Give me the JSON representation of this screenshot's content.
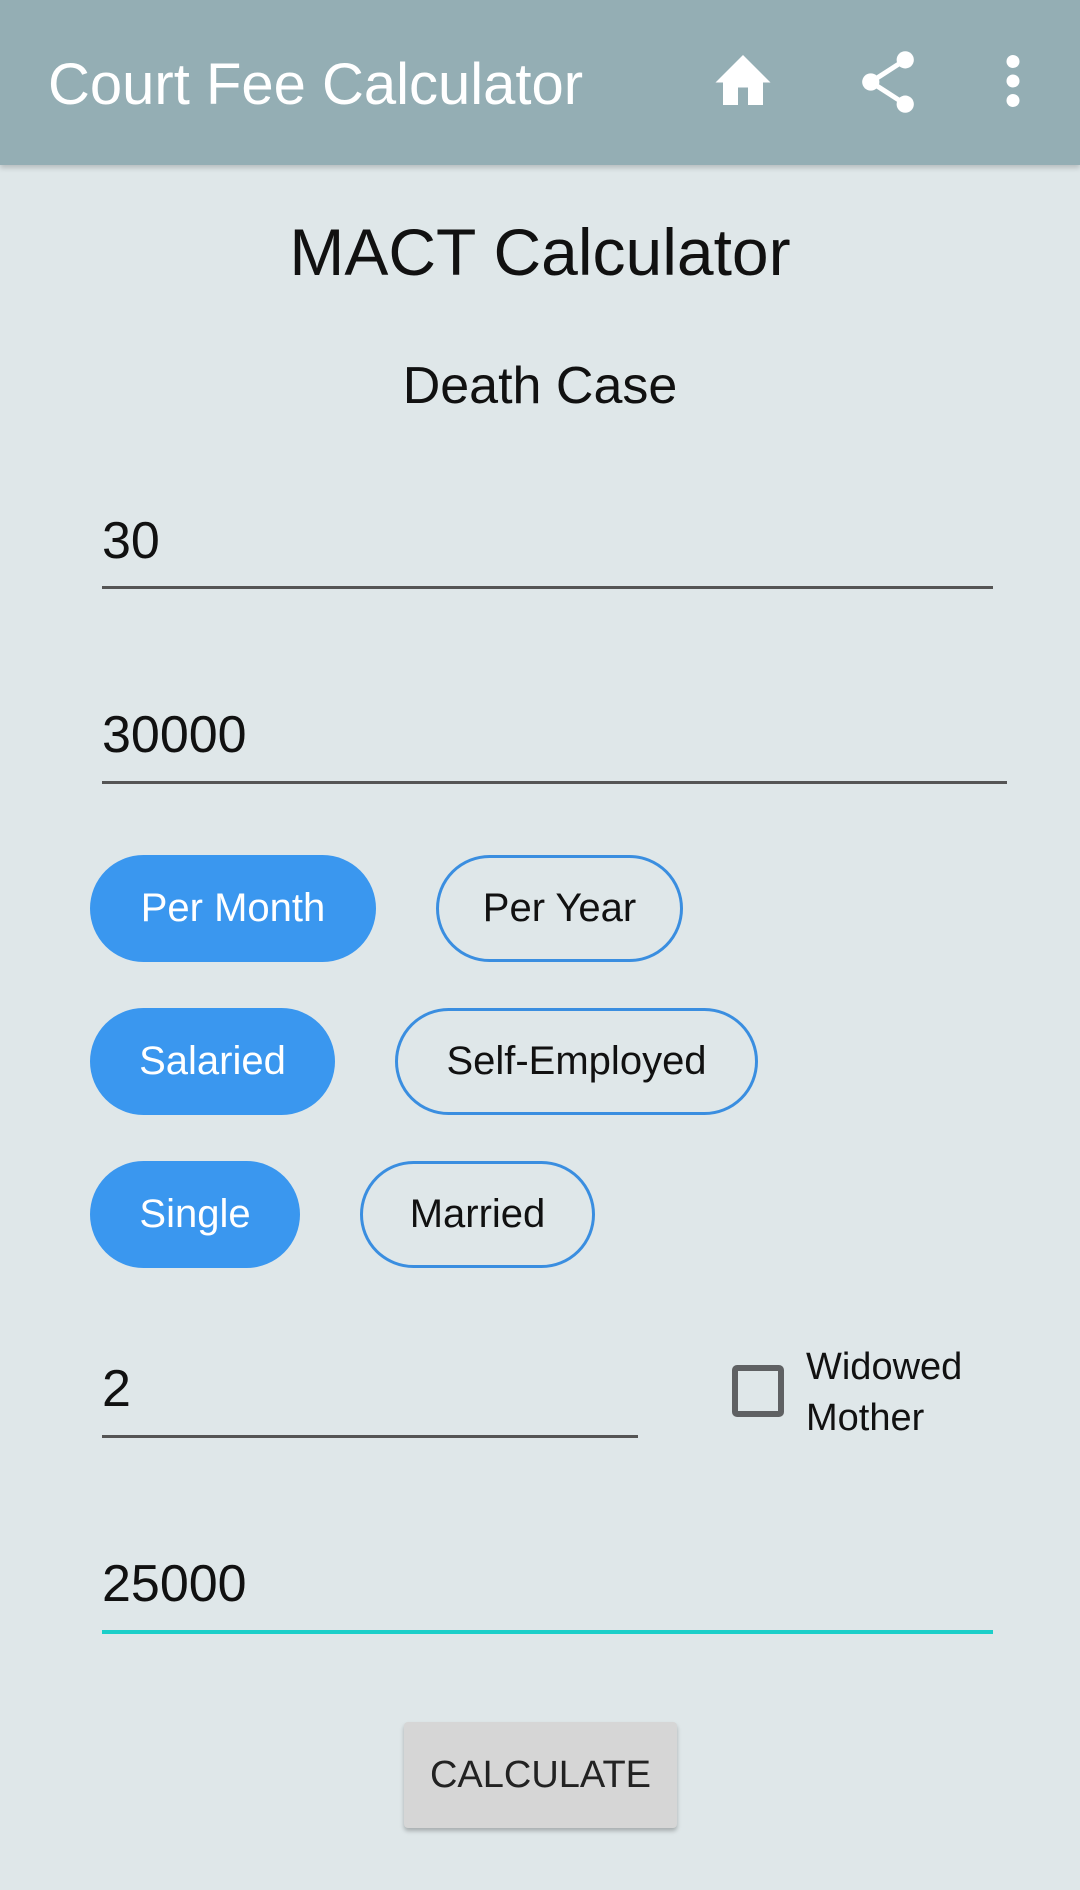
{
  "appbar": {
    "title": "Court Fee Calculator",
    "icons": [
      "home-icon",
      "share-icon",
      "more-vert-icon"
    ]
  },
  "page": {
    "title": "MACT Calculator",
    "subtitle": "Death Case"
  },
  "fields": {
    "age": "30",
    "income": "30000",
    "dependents": "2",
    "other": "25000"
  },
  "income_period": {
    "options": [
      "Per Month",
      "Per Year"
    ],
    "selected": "Per Month"
  },
  "employment": {
    "options": [
      "Salaried",
      "Self-Employed"
    ],
    "selected": "Salaried"
  },
  "marital": {
    "options": [
      "Single",
      "Married"
    ],
    "selected": "Single"
  },
  "widowed_mother": {
    "label_line1": "Widowed",
    "label_line2": "Mother",
    "checked": false
  },
  "calculate_label": "CALCULATE",
  "colors": {
    "appbar": "#94aeb4",
    "background": "#dfe7e9",
    "chip_selected": "#3a97ef",
    "focus_underline": "#1ccfc9"
  }
}
